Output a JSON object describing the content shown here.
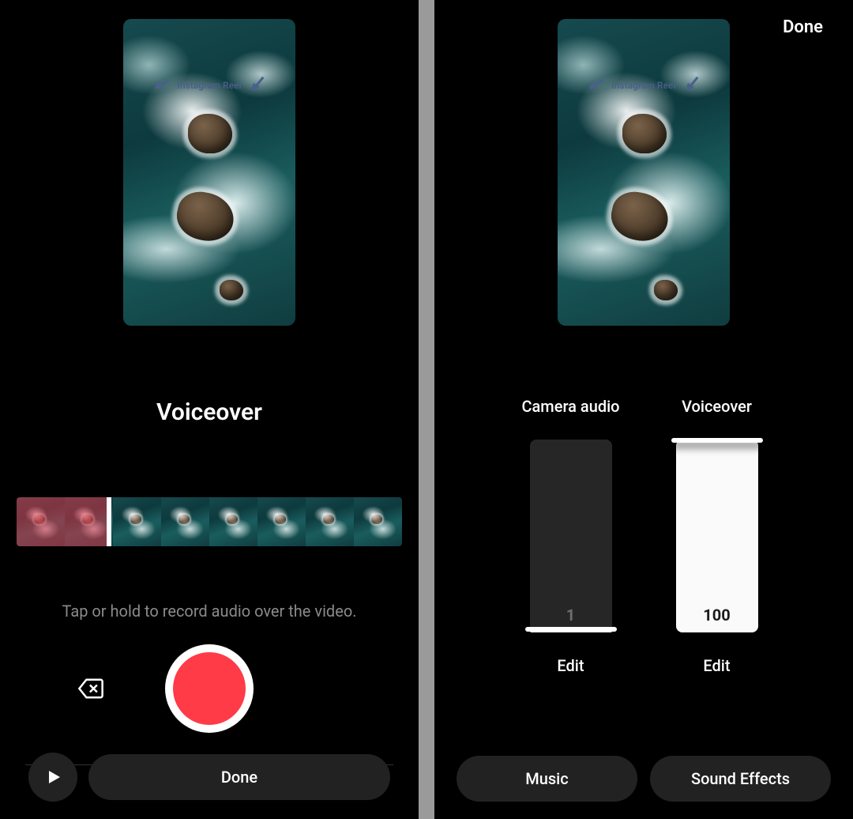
{
  "video_overlay_text": "Instagram Reel",
  "left": {
    "title": "Voiceover",
    "instruction": "Tap or hold to record audio over the video.",
    "done_label": "Done",
    "playhead_percent": 24,
    "frame_count": 8
  },
  "right": {
    "top_done_label": "Done",
    "channels": [
      {
        "label": "Camera audio",
        "value": 1,
        "edit_label": "Edit"
      },
      {
        "label": "Voiceover",
        "value": 100,
        "edit_label": "Edit"
      }
    ],
    "music_label": "Music",
    "sound_effects_label": "Sound Effects"
  }
}
